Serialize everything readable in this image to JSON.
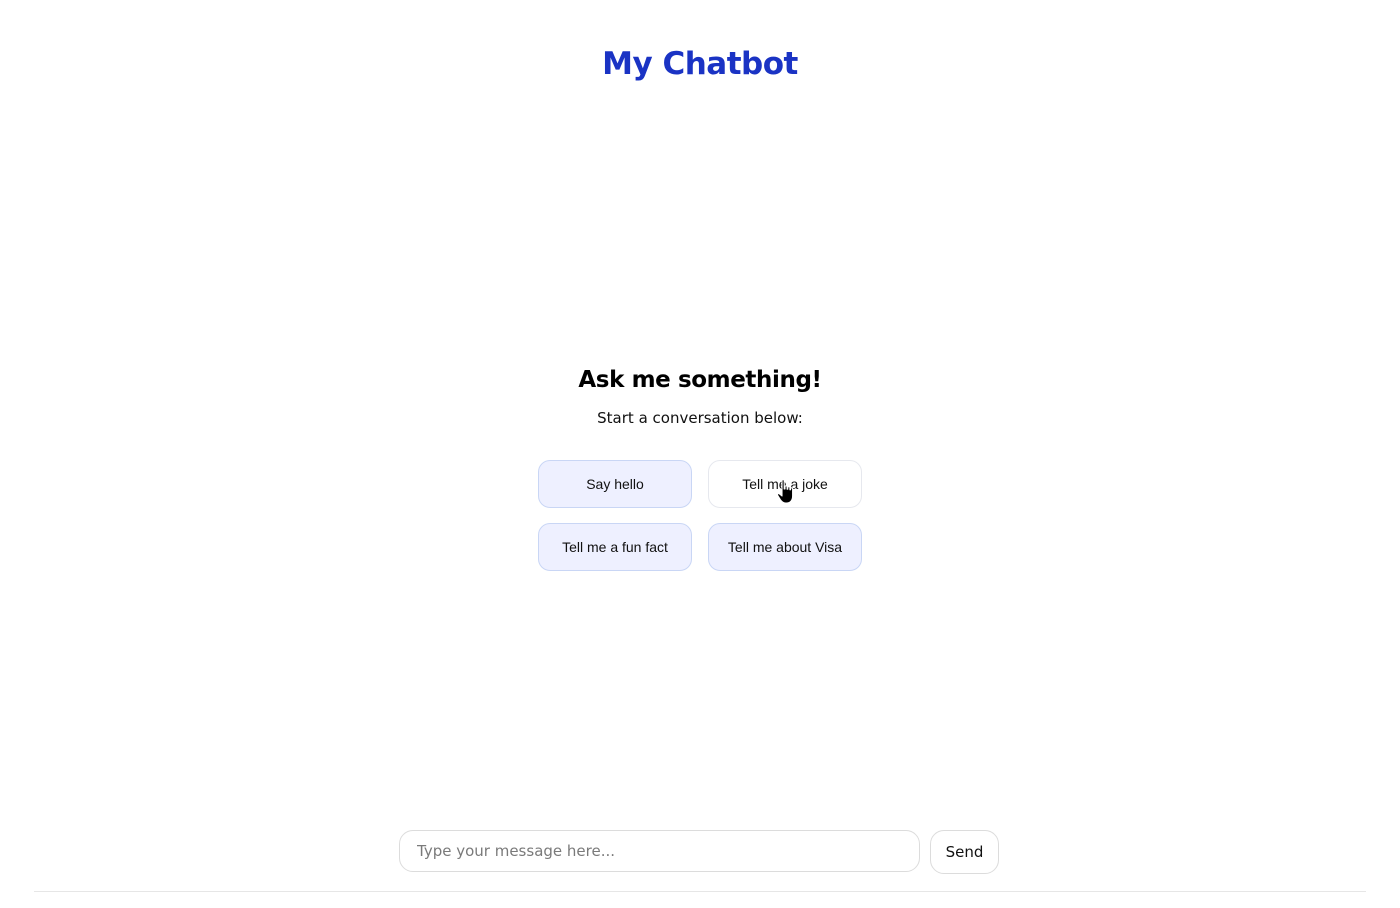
{
  "header": {
    "title": "My Chatbot",
    "title_color": "#1a33c4"
  },
  "welcome": {
    "heading": "Ask me something!",
    "subheading": "Start a conversation below:"
  },
  "suggestions": [
    {
      "label": "Say hello",
      "state": "default"
    },
    {
      "label": "Tell me a joke",
      "state": "hover"
    },
    {
      "label": "Tell me a fun fact",
      "state": "default"
    },
    {
      "label": "Tell me about Visa",
      "state": "default"
    }
  ],
  "composer": {
    "placeholder": "Type your message here...",
    "value": "",
    "send_label": "Send"
  },
  "colors": {
    "suggestion_bg": "#eef0ff",
    "suggestion_border": "#c9d6f5",
    "border": "#dcdcdc"
  },
  "cursor": {
    "icon": "hand-pointer-icon"
  }
}
